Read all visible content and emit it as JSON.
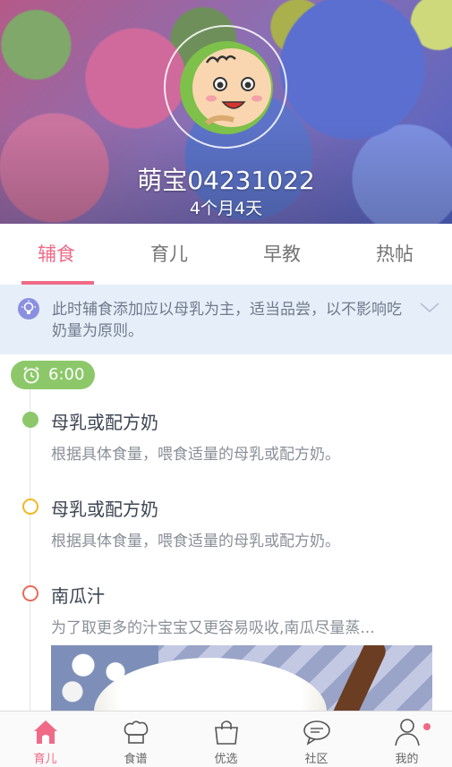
{
  "colors": {
    "accent": "#f06a87",
    "time_badge": "#8cc86a",
    "tip_bg": "#e6eefa"
  },
  "profile": {
    "name": "萌宝04231022",
    "age": "4个月4天"
  },
  "tabs": [
    {
      "label": "辅食",
      "active": true
    },
    {
      "label": "育儿",
      "active": false
    },
    {
      "label": "早教",
      "active": false
    },
    {
      "label": "热帖",
      "active": false
    }
  ],
  "tip": {
    "icon": "lightbulb-icon",
    "text": "此时辅食添加应以母乳为主，适当品尝，以不影响吃奶量为原则。"
  },
  "timeline": {
    "time": "6:00",
    "entries": [
      {
        "title": "母乳或配方奶",
        "desc": "根据具体食量，喂食适量的母乳或配方奶。",
        "dot_color": "#8cc86a",
        "dot_style": "filled"
      },
      {
        "title": "母乳或配方奶",
        "desc": "根据具体食量，喂食适量的母乳或配方奶。",
        "dot_color": "#f2b824",
        "dot_style": "outline"
      },
      {
        "title": "南瓜汁",
        "desc": "为了取更多的汁宝宝又更容易吸收,南瓜尽量蒸...",
        "dot_color": "#e86a5a",
        "dot_style": "outline"
      }
    ]
  },
  "bottom_nav": [
    {
      "label": "育儿",
      "icon": "home-icon",
      "active": true
    },
    {
      "label": "食谱",
      "icon": "chef-hat-icon",
      "active": false
    },
    {
      "label": "优选",
      "icon": "shopping-bag-icon",
      "active": false
    },
    {
      "label": "社区",
      "icon": "chat-bubble-icon",
      "active": false
    },
    {
      "label": "我的",
      "icon": "person-icon",
      "active": false,
      "notification_dot": true
    }
  ]
}
